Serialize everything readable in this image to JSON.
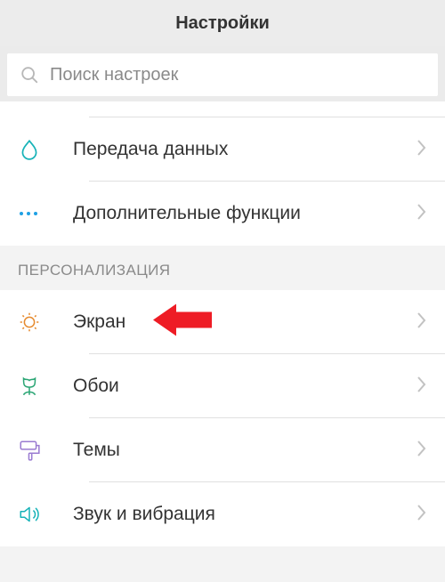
{
  "header": {
    "title": "Настройки"
  },
  "search": {
    "placeholder": "Поиск настроек"
  },
  "top_items": [
    {
      "label": "Передача данных"
    },
    {
      "label": "Дополнительные функции"
    }
  ],
  "group": {
    "title": "ПЕРСОНАЛИЗАЦИЯ"
  },
  "items": [
    {
      "label": "Экран"
    },
    {
      "label": "Обои"
    },
    {
      "label": "Темы"
    },
    {
      "label": "Звук и вибрация"
    }
  ],
  "colors": {
    "accent": "#17b3b8",
    "arrow": "#ee1c25"
  }
}
